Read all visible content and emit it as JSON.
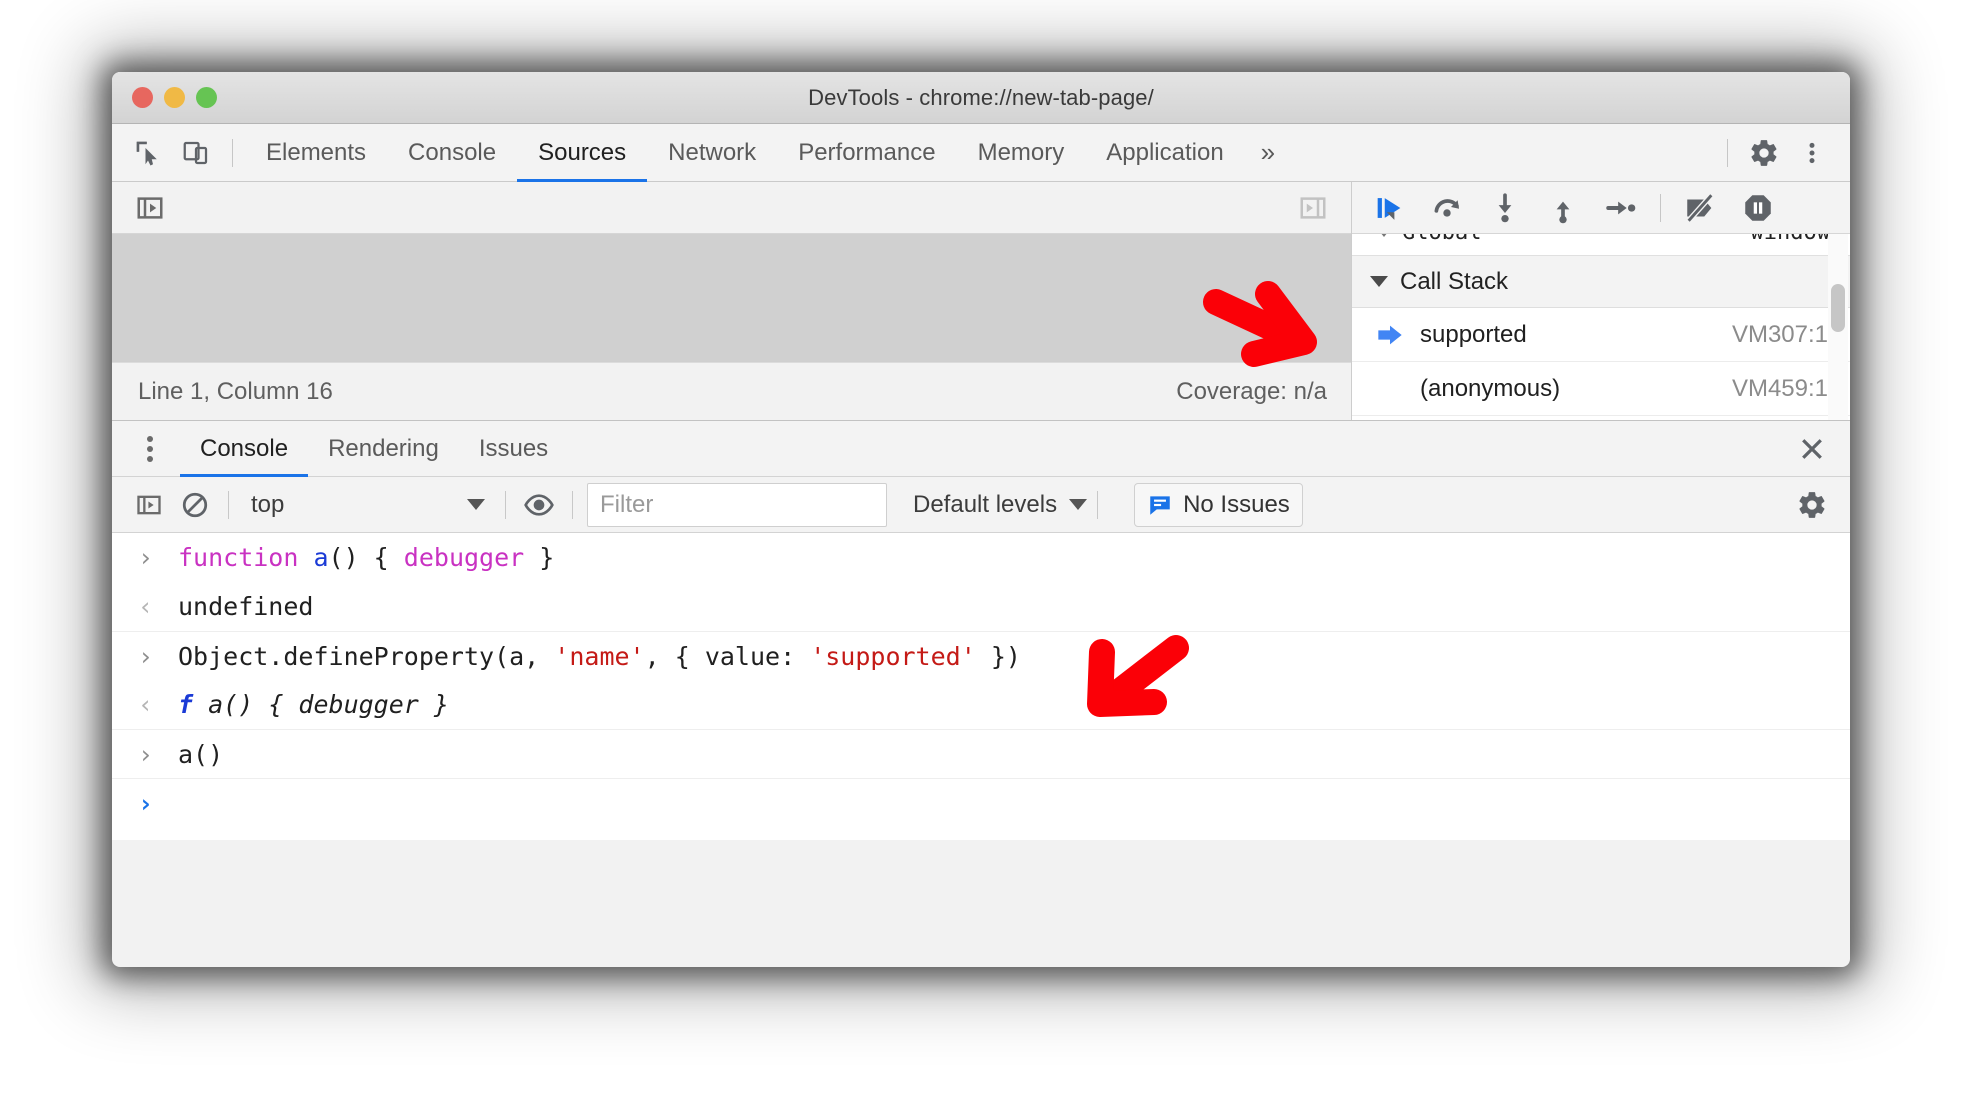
{
  "window": {
    "title": "DevTools - chrome://new-tab-page/",
    "traffic_lights": [
      "close",
      "minimize",
      "maximize"
    ],
    "colors": {
      "red": "#e7675f",
      "yellow": "#f0b945",
      "green": "#66c453",
      "accent": "#1a73e8"
    }
  },
  "main_toolbar": {
    "icons": [
      "inspect-element-icon",
      "device-toolbar-icon"
    ],
    "tabs": [
      {
        "label": "Elements",
        "active": false
      },
      {
        "label": "Console",
        "active": false
      },
      {
        "label": "Sources",
        "active": true
      },
      {
        "label": "Network",
        "active": false
      },
      {
        "label": "Performance",
        "active": false
      },
      {
        "label": "Memory",
        "active": false
      },
      {
        "label": "Application",
        "active": false
      }
    ],
    "more_tabs_label": "»",
    "right_icons": [
      "settings-gear-icon",
      "more-options-kebab-icon"
    ]
  },
  "sources": {
    "left_toolbar_icon": "show-navigator-icon",
    "right_toolbar_icon": "show-debugger-icon",
    "editor_placeholder": "",
    "status": {
      "cursor_position": "Line 1, Column 16",
      "coverage": "Coverage: n/a"
    }
  },
  "debugger": {
    "controls": [
      {
        "name": "resume-script-execution-icon",
        "active": true
      },
      {
        "name": "step-over-next-function-call-icon",
        "active": false
      },
      {
        "name": "step-into-next-function-call-icon",
        "active": false
      },
      {
        "name": "step-out-of-current-function-icon",
        "active": false
      },
      {
        "name": "step-icon",
        "active": false
      },
      {
        "name": "deactivate-breakpoints-icon",
        "active": false
      },
      {
        "name": "pause-on-exceptions-icon",
        "active": false
      }
    ],
    "scope_clipped_row": {
      "name": "Global",
      "value": "window"
    },
    "call_stack": {
      "header": "Call Stack",
      "expanded": true,
      "frames": [
        {
          "name": "supported",
          "location": "VM307:1",
          "current": true
        },
        {
          "name": "(anonymous)",
          "location": "VM459:1",
          "current": false
        }
      ]
    }
  },
  "drawer": {
    "tabs": [
      {
        "label": "Console",
        "active": true
      },
      {
        "label": "Rendering",
        "active": false
      },
      {
        "label": "Issues",
        "active": false
      }
    ],
    "close_label": "✕"
  },
  "console_toolbar": {
    "sidebar_toggle_icon": "show-console-sidebar-icon",
    "clear_icon": "clear-console-icon",
    "context": {
      "value": "top"
    },
    "eye_icon": "live-expression-eye-icon",
    "filter": {
      "value": "",
      "placeholder": "Filter"
    },
    "levels": {
      "label": "Default levels"
    },
    "issues": {
      "label": "No Issues",
      "icon": "issues-message-icon"
    },
    "settings_icon": "console-settings-gear-icon"
  },
  "console_rows": [
    {
      "kind": "input",
      "glyph": "›",
      "tokens": [
        {
          "t": "function ",
          "c": "kw"
        },
        {
          "t": "a",
          "c": "fnam"
        },
        {
          "t": "() { ",
          "c": "pun"
        },
        {
          "t": "debugger",
          "c": "kw"
        },
        {
          "t": " }",
          "c": "pun"
        }
      ],
      "plain": "function a() { debugger }"
    },
    {
      "kind": "output",
      "glyph": "‹",
      "tokens": [
        {
          "t": "undefined",
          "c": "pun"
        }
      ],
      "plain": "undefined"
    },
    {
      "kind": "input",
      "glyph": "›",
      "tokens": [
        {
          "t": "Object.defineProperty(a, ",
          "c": "pun"
        },
        {
          "t": "'name'",
          "c": "str"
        },
        {
          "t": ", { value: ",
          "c": "pun"
        },
        {
          "t": "'supported'",
          "c": "str"
        },
        {
          "t": " })",
          "c": "pun"
        }
      ],
      "plain": "Object.defineProperty(a, 'name', { value: 'supported' })"
    },
    {
      "kind": "output",
      "glyph": "‹",
      "tokens": [
        {
          "t": "f ",
          "c": "fitalic"
        },
        {
          "t": "a() { debugger }",
          "c": "ital"
        }
      ],
      "plain": "f a() { debugger }"
    },
    {
      "kind": "input",
      "glyph": "›",
      "tokens": [
        {
          "t": "a()",
          "c": "pun"
        }
      ],
      "plain": "a()"
    },
    {
      "kind": "prompt",
      "glyph": "›",
      "tokens": [],
      "plain": ""
    }
  ],
  "annotations": [
    {
      "name": "red-arrow-call-stack-frame",
      "direction": "down-right"
    },
    {
      "name": "red-arrow-define-property",
      "direction": "down-left"
    }
  ]
}
